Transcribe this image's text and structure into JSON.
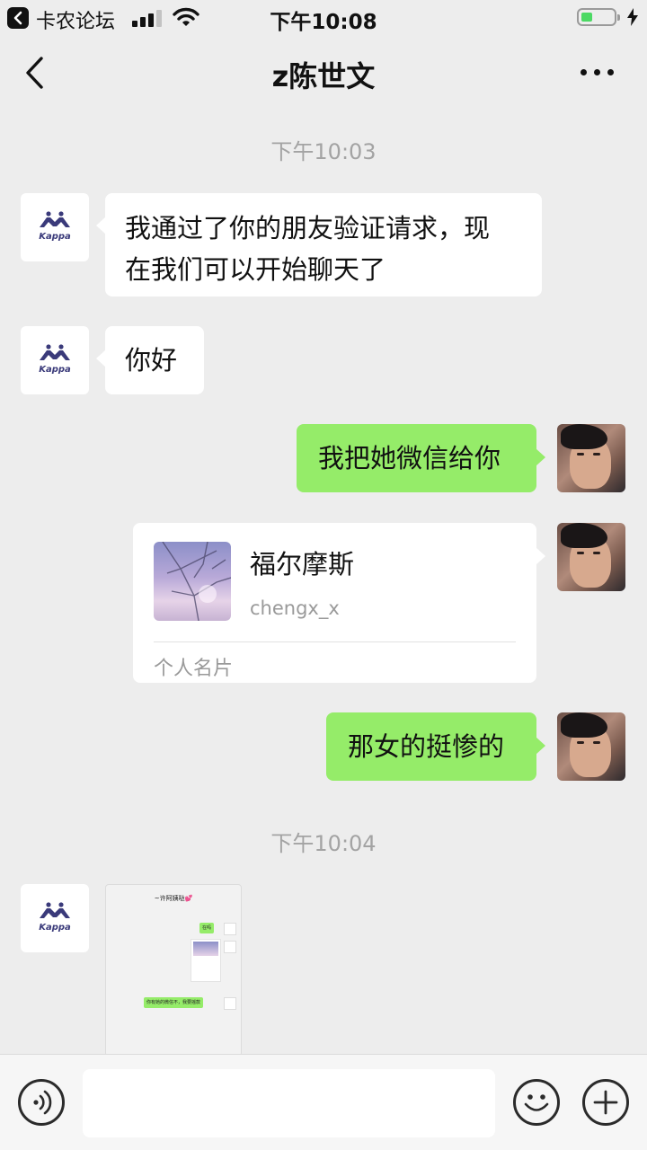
{
  "status_bar": {
    "back_app_label": "卡农论坛",
    "time": "下午10:08",
    "icons": [
      "back-to-app-icon",
      "signal-icon",
      "wifi-icon",
      "battery-icon",
      "charging-bolt-icon"
    ],
    "battery_level": 0.25,
    "battery_color": "#4cd964"
  },
  "nav": {
    "title": "z陈世文",
    "back_icon": "chevron-left-icon",
    "more_icon": "more-dots-icon"
  },
  "colors": {
    "background": "#ededed",
    "bubble_sent": "#95ec69",
    "bubble_received": "#ffffff",
    "timestamp": "#a3a3a3"
  },
  "messages": {
    "timestamp_1": "下午10:03",
    "msg_1_line1": "我通过了你的朋友验证请求，现",
    "msg_1_line2": "在我们可以开始聊天了",
    "msg_2": "你好",
    "msg_3": "我把她微信给你",
    "card": {
      "name": "福尔摩斯",
      "id": "chengx_x",
      "type": "个人名片"
    },
    "msg_4": "那女的挺惨的",
    "timestamp_2": "下午10:04",
    "image_thumbnail": {
      "title": "~许阿姨哒💕",
      "bubble_1": "在吗",
      "bubble_2": "你有她的微信不，我要摇款"
    }
  },
  "input_bar": {
    "voice_icon": "voice-icon",
    "emoji_icon": "emoji-icon",
    "plus_icon": "plus-icon",
    "text_value": ""
  }
}
